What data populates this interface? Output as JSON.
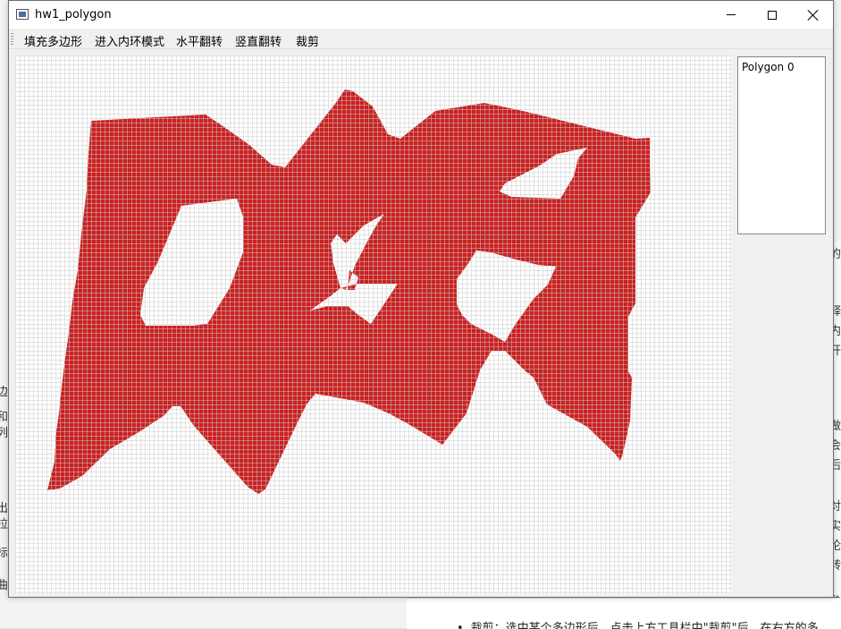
{
  "window": {
    "title": "hw1_polygon",
    "minimize_label": "",
    "maximize_label": "",
    "close_label": ""
  },
  "menu": {
    "items": [
      {
        "label": "填充多边形"
      },
      {
        "label": "进入内环模式"
      },
      {
        "label": "水平翻转"
      },
      {
        "label": "竖直翻转"
      },
      {
        "label": "裁剪"
      }
    ]
  },
  "polygon_list": {
    "items": [
      {
        "label": "Polygon 0"
      }
    ]
  },
  "background_doc": {
    "bottom_text": "裁剪：选中某个多边形后，点击上方工具栏中\"裁剪\"后，在右方的多",
    "right_fragments": [
      "的",
      "；",
      "释",
      "内",
      "开",
      "做",
      "会",
      "后",
      "对",
      "实",
      "论",
      "转",
      "参"
    ],
    "left_fragments": [
      "边",
      "和",
      "列",
      "出",
      "拉",
      "标",
      "曲"
    ]
  },
  "colors": {
    "fill": "#cc2020",
    "grid": "#c8c8c8",
    "canvas_bg": "#ffffff"
  }
}
